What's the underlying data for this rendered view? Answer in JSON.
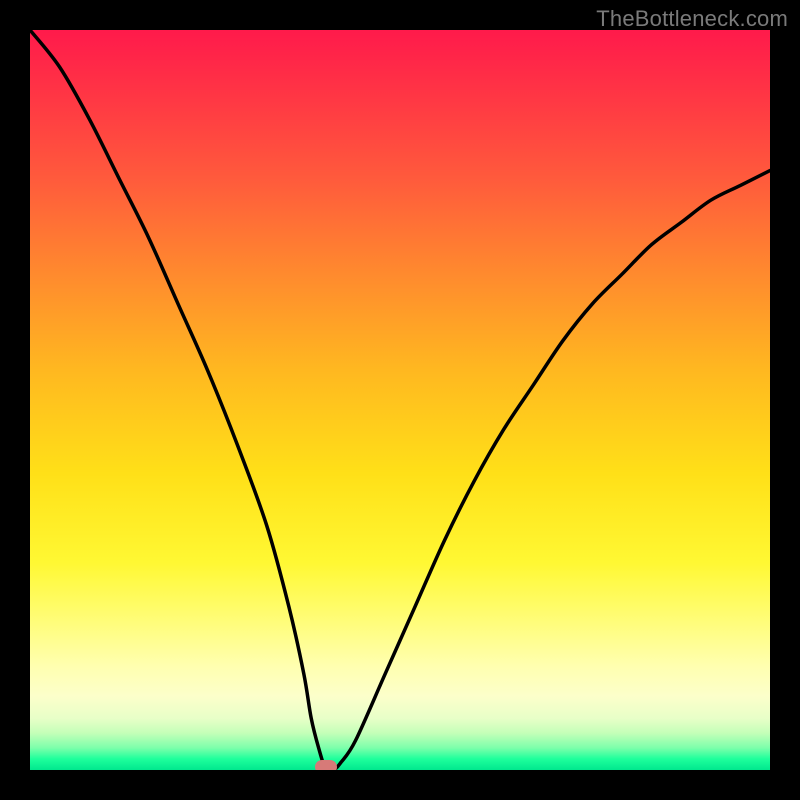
{
  "watermark": "TheBottleneck.com",
  "chart_data": {
    "type": "line",
    "title": "",
    "xlabel": "",
    "ylabel": "",
    "xlim": [
      0,
      100
    ],
    "ylim": [
      0,
      100
    ],
    "marker": {
      "x": 40,
      "y": 0
    },
    "series": [
      {
        "name": "curve",
        "x": [
          0,
          4,
          8,
          12,
          16,
          20,
          24,
          28,
          32,
          35,
          37,
          38,
          39,
          40,
          41,
          42,
          44,
          48,
          52,
          56,
          60,
          64,
          68,
          72,
          76,
          80,
          84,
          88,
          92,
          96,
          100
        ],
        "y": [
          100,
          95,
          88,
          80,
          72,
          63,
          54,
          44,
          33,
          22,
          13,
          7,
          3,
          0,
          0,
          1,
          4,
          13,
          22,
          31,
          39,
          46,
          52,
          58,
          63,
          67,
          71,
          74,
          77,
          79,
          81
        ]
      }
    ]
  }
}
